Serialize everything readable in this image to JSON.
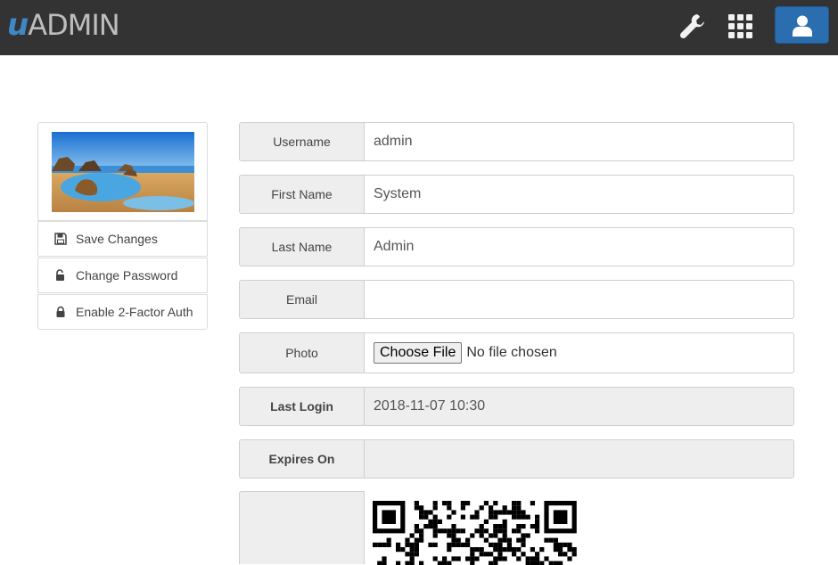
{
  "header": {
    "logo_prefix": "u",
    "logo_name": "ADMIN",
    "icons": [
      "wrench-icon",
      "apps-grid-icon",
      "user-icon"
    ],
    "accent_color": "#2a6eb0"
  },
  "sidebar": {
    "buttons": [
      {
        "label": "Save Changes",
        "icon": "save-icon"
      },
      {
        "label": "Change Password",
        "icon": "unlock-icon"
      },
      {
        "label": "Enable 2-Factor Auth",
        "icon": "lock-icon"
      }
    ]
  },
  "form": {
    "username": {
      "label": "Username",
      "value": "admin"
    },
    "first_name": {
      "label": "First Name",
      "value": "System"
    },
    "last_name": {
      "label": "Last Name",
      "value": "Admin"
    },
    "email": {
      "label": "Email",
      "value": ""
    },
    "photo": {
      "label": "Photo",
      "button": "Choose File",
      "status": "No file chosen"
    },
    "last_login": {
      "label": "Last Login",
      "value": "2018-11-07 10:30"
    },
    "expires_on": {
      "label": "Expires On",
      "value": ""
    }
  }
}
